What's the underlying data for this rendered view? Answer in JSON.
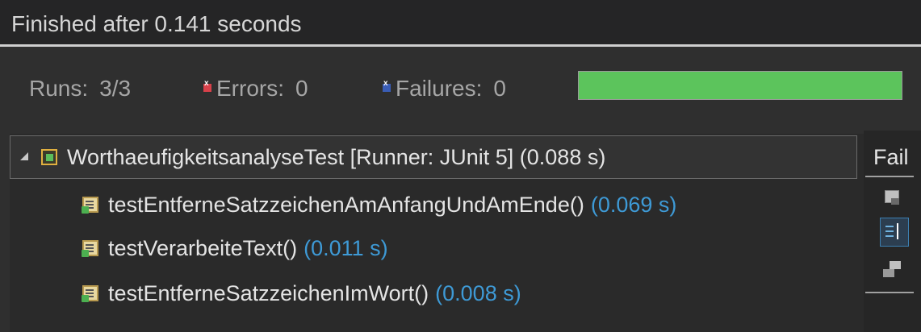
{
  "status": {
    "message": "Finished after 0.141 seconds"
  },
  "counters": {
    "runs_label": "Runs:",
    "runs_value": "3/3",
    "errors_label": "Errors:",
    "errors_value": "0",
    "failures_label": "Failures:",
    "failures_value": "0"
  },
  "progress": {
    "fraction": 1.0,
    "color": "#5cc45c"
  },
  "tree": {
    "suite": {
      "label": "WorthaeufigkeitsanalyseTest [Runner: JUnit 5] (0.088 s)",
      "icon": "test-suite-pass-icon"
    },
    "cases": [
      {
        "name": "testEntferneSatzzeichenAmAnfangUndAmEnde()",
        "time": "(0.069 s)",
        "icon": "test-case-pass-icon"
      },
      {
        "name": "testVerarbeiteText()",
        "time": "(0.011 s)",
        "icon": "test-case-pass-icon"
      },
      {
        "name": "testEntferneSatzzeichenImWort()",
        "time": "(0.008 s)",
        "icon": "test-case-pass-icon"
      }
    ]
  },
  "side_panel": {
    "label": "Fail",
    "buttons": [
      {
        "icon": "next-failure-icon"
      },
      {
        "icon": "show-failures-only-icon",
        "active": true
      },
      {
        "icon": "test-run-history-icon"
      }
    ]
  },
  "colors": {
    "time": "#3e9ad6",
    "error": "#d8414a",
    "failure": "#3a5db6",
    "success": "#5cc45c"
  }
}
